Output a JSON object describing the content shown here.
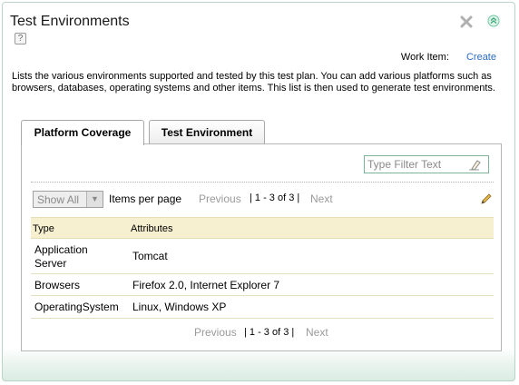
{
  "widget": {
    "title": "Test Environments",
    "help_glyph": "?",
    "close_icon": "close-icon",
    "collapse_icon": "collapse-icon"
  },
  "work_item": {
    "label": "Work Item:",
    "link": "Create"
  },
  "description": "Lists the various environments supported and tested by this test plan. You can add various platforms such as browsers, databases, operating systems and other items. This list is then used to generate test environments.",
  "tabs": [
    {
      "label": "Platform Coverage",
      "active": true
    },
    {
      "label": "Test Environment",
      "active": false
    }
  ],
  "filter": {
    "placeholder": "Type Filter Text",
    "icon": "eraser-icon"
  },
  "pager": {
    "show_select": "Show All",
    "items_per_page": "Items per page",
    "previous": "Previous",
    "range": "| 1 - 3 of 3 |",
    "next": "Next"
  },
  "table": {
    "columns": [
      "Type",
      "Attributes"
    ],
    "rows": [
      {
        "type_line1": "Application",
        "type_line2": "Server",
        "attributes": "Tomcat"
      },
      {
        "type": "Browsers",
        "attributes": "Firefox 2.0, Internet Explorer 7"
      },
      {
        "type": "OperatingSystem",
        "attributes": "Linux, Windows XP"
      }
    ]
  },
  "colors": {
    "accent_border": "#b9d3c6",
    "link": "#2a6cc4",
    "header_bg": "#f7f0d0",
    "filter_border": "#7fb39a"
  }
}
